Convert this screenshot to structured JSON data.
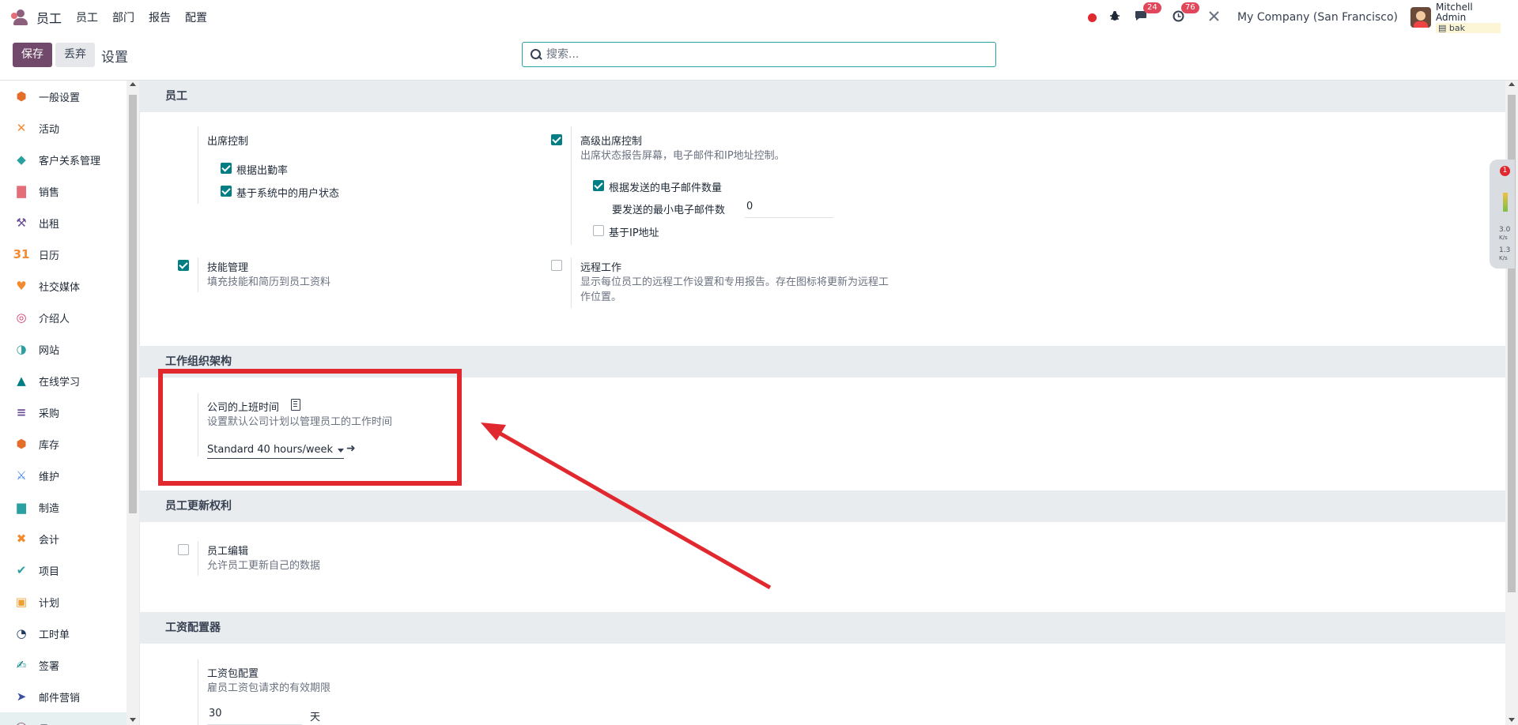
{
  "navbar": {
    "app_name": "员工",
    "menu": [
      "员工",
      "部门",
      "报告",
      "配置"
    ],
    "messages_badge": "24",
    "activities_badge": "76",
    "company": "My Company (San Francisco)",
    "user_name": "Mitchell Admin",
    "user_db": "bak"
  },
  "control": {
    "save_label": "保存",
    "discard_label": "丢弃",
    "title": "设置",
    "search_placeholder": "搜索..."
  },
  "sidebar": {
    "items": [
      {
        "label": "一般设置",
        "icon": "settings-icon",
        "color": "#e36e29"
      },
      {
        "label": "活动",
        "icon": "activity-icon",
        "color": "#f28b30"
      },
      {
        "label": "客户关系管理",
        "icon": "crm-icon",
        "color": "#2aa0a0"
      },
      {
        "label": "销售",
        "icon": "sales-icon",
        "color": "#e46e78"
      },
      {
        "label": "出租",
        "icon": "rental-icon",
        "color": "#6a4c93"
      },
      {
        "label": "日历",
        "icon": "calendar-icon",
        "color": "#f28b30"
      },
      {
        "label": "社交媒体",
        "icon": "social-icon",
        "color": "#f28b30"
      },
      {
        "label": "介绍人",
        "icon": "referral-icon",
        "color": "#d13d6b"
      },
      {
        "label": "网站",
        "icon": "website-icon",
        "color": "#2aa0a0"
      },
      {
        "label": "在线学习",
        "icon": "elearning-icon",
        "color": "#017e84"
      },
      {
        "label": "采购",
        "icon": "purchase-icon",
        "color": "#6a4c93"
      },
      {
        "label": "库存",
        "icon": "inventory-icon",
        "color": "#e36e29"
      },
      {
        "label": "维护",
        "icon": "maintenance-icon",
        "color": "#3b82f6"
      },
      {
        "label": "制造",
        "icon": "manufacturing-icon",
        "color": "#2aa0a0"
      },
      {
        "label": "会计",
        "icon": "accounting-icon",
        "color": "#f28b30"
      },
      {
        "label": "项目",
        "icon": "project-icon",
        "color": "#2aa0a0"
      },
      {
        "label": "计划",
        "icon": "planning-icon",
        "color": "#f0a030"
      },
      {
        "label": "工时单",
        "icon": "timesheet-icon",
        "color": "#1e3a5f"
      },
      {
        "label": "签署",
        "icon": "sign-icon",
        "color": "#017e84"
      },
      {
        "label": "邮件营销",
        "icon": "email-marketing-icon",
        "color": "#3b4fa0"
      },
      {
        "label": "员工",
        "icon": "employees-icon",
        "color": "#8e5f7d"
      }
    ]
  },
  "sections": {
    "employee": "员工",
    "work_org": "工作组织架构",
    "employee_update": "员工更新权利",
    "payroll": "工资配置器"
  },
  "settings": {
    "attendance_title": "出席控制",
    "attendance_opt1": "根据出勤率",
    "attendance_opt2": "基于系统中的用户状态",
    "adv_title": "高级出席控制",
    "adv_desc": "出席状态报告屏幕，电子邮件和IP地址控制。",
    "adv_opt1": "根据发送的电子邮件数量",
    "adv_min_label": "要发送的最小电子邮件数",
    "adv_min_value": "0",
    "adv_opt2": "基于IP地址",
    "skills_title": "技能管理",
    "skills_desc": "填充技能和简历到员工资料",
    "remote_title": "远程工作",
    "remote_desc": "显示每位员工的远程工作设置和专用报告。存在图标将更新为远程工作位置。",
    "hours_title": "公司的上班时间",
    "hours_desc": "设置默认公司计划以管理员工的工作时间",
    "hours_value": "Standard 40 hours/week",
    "edit_title": "员工编辑",
    "edit_desc": "允许员工更新自己的数据",
    "package_title": "工资包配置",
    "package_desc": "雇员工资包请求的有效期限",
    "package_value": "30",
    "package_unit": "天"
  },
  "widget": {
    "badge": "1",
    "up": "3.0",
    "up_unit": "K/s",
    "down": "1.3",
    "down_unit": "K/s"
  },
  "colors": {
    "primary": "#71496b",
    "accent": "#017e84",
    "annotation": "#e0282e"
  }
}
